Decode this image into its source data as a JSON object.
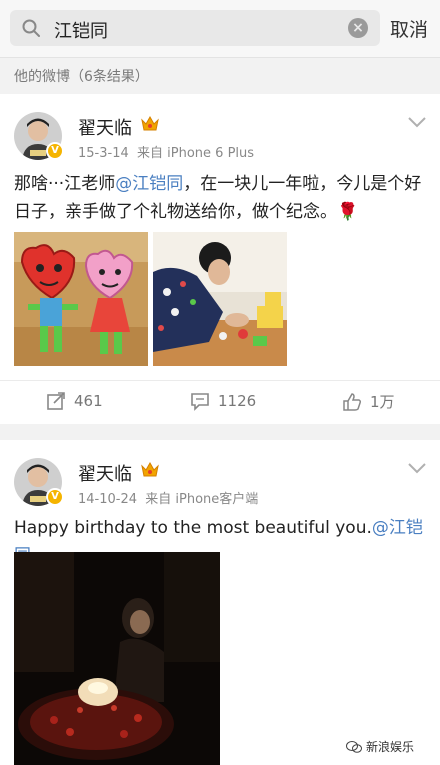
{
  "search": {
    "query": "江铠同",
    "cancel_label": "取消"
  },
  "results_label": "他的微博（6条结果）",
  "posts": [
    {
      "author": "翟天临",
      "date": "15-3-14",
      "source": "来自 iPhone 6 Plus",
      "text_before": "那啥···江老师",
      "mention": "@江铠同",
      "text_after": "，在一块儿一年啦，今儿是个好日子，亲手做了个礼物送给你，做个纪念。",
      "emoji": "🌹",
      "actions": {
        "repost": "461",
        "comment": "1126",
        "like": "1万"
      }
    },
    {
      "author": "翟天临",
      "date": "14-10-24",
      "source": "来自 iPhone客户端",
      "text_before": "Happy birthday to the most beautiful you.",
      "mention": "@江铠同"
    }
  ],
  "watermark": "新浪娱乐",
  "colors": {
    "mention": "#4a7fc1",
    "badge": "#f5b400"
  }
}
